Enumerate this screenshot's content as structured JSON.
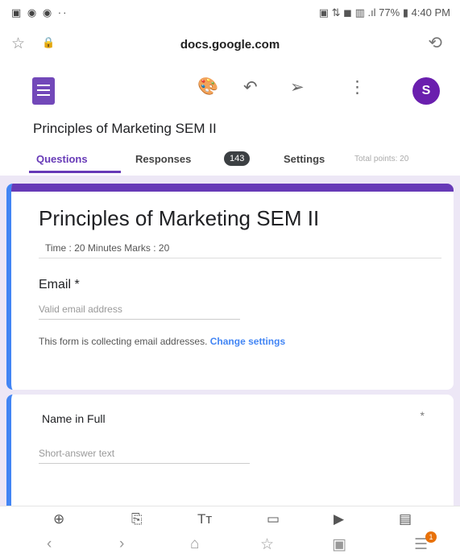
{
  "status_bar": {
    "left_icons": "▣ ◉ ◉ ··",
    "right_text": "▣ ⇅ ◼ ▥ .ıl 77% ▮ 4:40 PM"
  },
  "browser": {
    "url": "docs.google.com",
    "star_icon": "☆",
    "lock_icon": "🔒",
    "reload_icon": "⟲"
  },
  "toolbar": {
    "palette_icon": "🎨",
    "undo_icon": "↶",
    "send_icon": "➢",
    "more_icon": "⋮",
    "avatar_letter": "S"
  },
  "form": {
    "title": "Principles of Marketing SEM II",
    "tabs": {
      "questions": "Questions",
      "responses": "Responses",
      "responses_count": "143",
      "settings": "Settings",
      "total_points": "Total points: 20"
    },
    "header_card": {
      "title": "Principles of Marketing SEM II",
      "description": "Time : 20 Minutes    Marks : 20",
      "email_label": "Email *",
      "email_placeholder": "Valid email address",
      "collecting_text": "This form is collecting email addresses.",
      "change_settings": "Change settings"
    },
    "question_card": {
      "title": "Name in Full",
      "required": "*",
      "placeholder": "Short-answer text"
    }
  },
  "add_bar": {
    "add_question": "⊕",
    "import": "⎘",
    "title_text": "Tт",
    "image": "▭",
    "video": "▶",
    "section": "▤"
  },
  "nav": {
    "back": "‹",
    "forward": "›",
    "home": "⌂",
    "bookmark": "☆",
    "tabs": "▣",
    "menu": "☰",
    "notif_count": "1"
  }
}
